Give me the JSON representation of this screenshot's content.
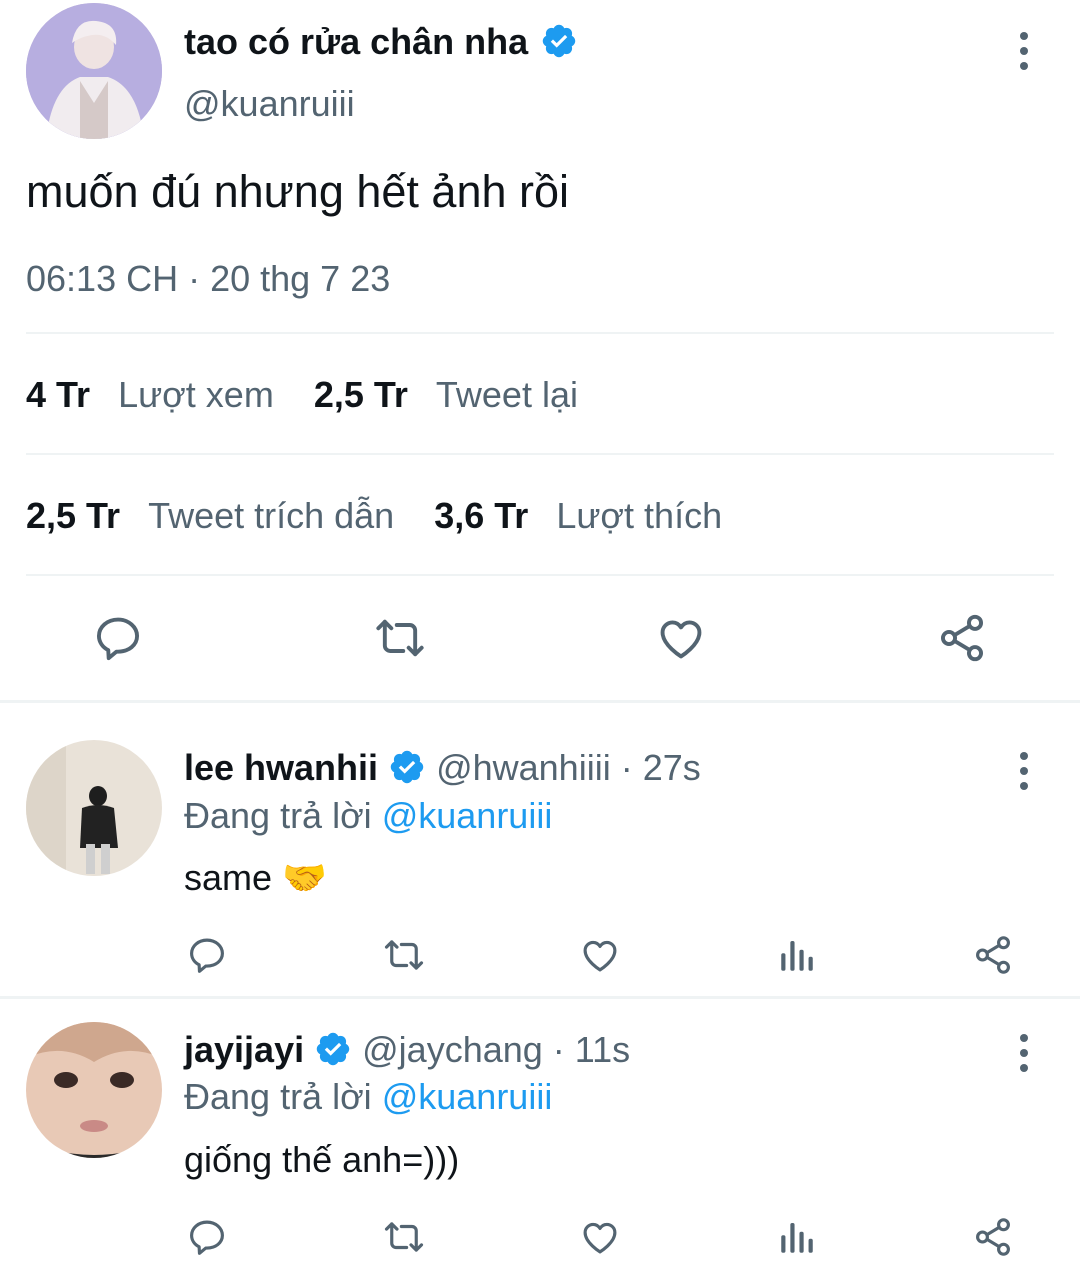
{
  "main_tweet": {
    "display_name": "tao có rửa chân nha",
    "handle": "@kuanruiii",
    "text": "muốn đú nhưng hết ảnh rồi",
    "timestamp": "06:13 CH · 20 thg 7 23",
    "stats": {
      "views_count": "4 Tr",
      "views_label": "Lượt xem",
      "retweets_count": "2,5 Tr",
      "retweets_label": "Tweet lại",
      "quotes_count": "2,5 Tr",
      "quotes_label": "Tweet trích dẫn",
      "likes_count": "3,6 Tr",
      "likes_label": "Lượt thích"
    }
  },
  "replies": [
    {
      "display_name": "lee hwanhii",
      "handle": "@hwanhiiii",
      "time": "· 27s",
      "replying_prefix": "Đang trả lời",
      "replying_to": "@kuanruiii",
      "text": "same 🤝"
    },
    {
      "display_name": "jayijayi",
      "handle": "@jaychang",
      "time": "· 11s",
      "replying_prefix": "Đang trả lời",
      "replying_to": "@kuanruiii",
      "text": "giống thế anh=)))"
    }
  ],
  "colors": {
    "accent": "#1d9bf0",
    "muted_text": "#536471",
    "divider": "#eff3f4"
  },
  "icons": [
    "more-vertical-icon",
    "verified-badge-icon",
    "reply-icon",
    "retweet-icon",
    "like-icon",
    "share-icon",
    "views-icon"
  ]
}
